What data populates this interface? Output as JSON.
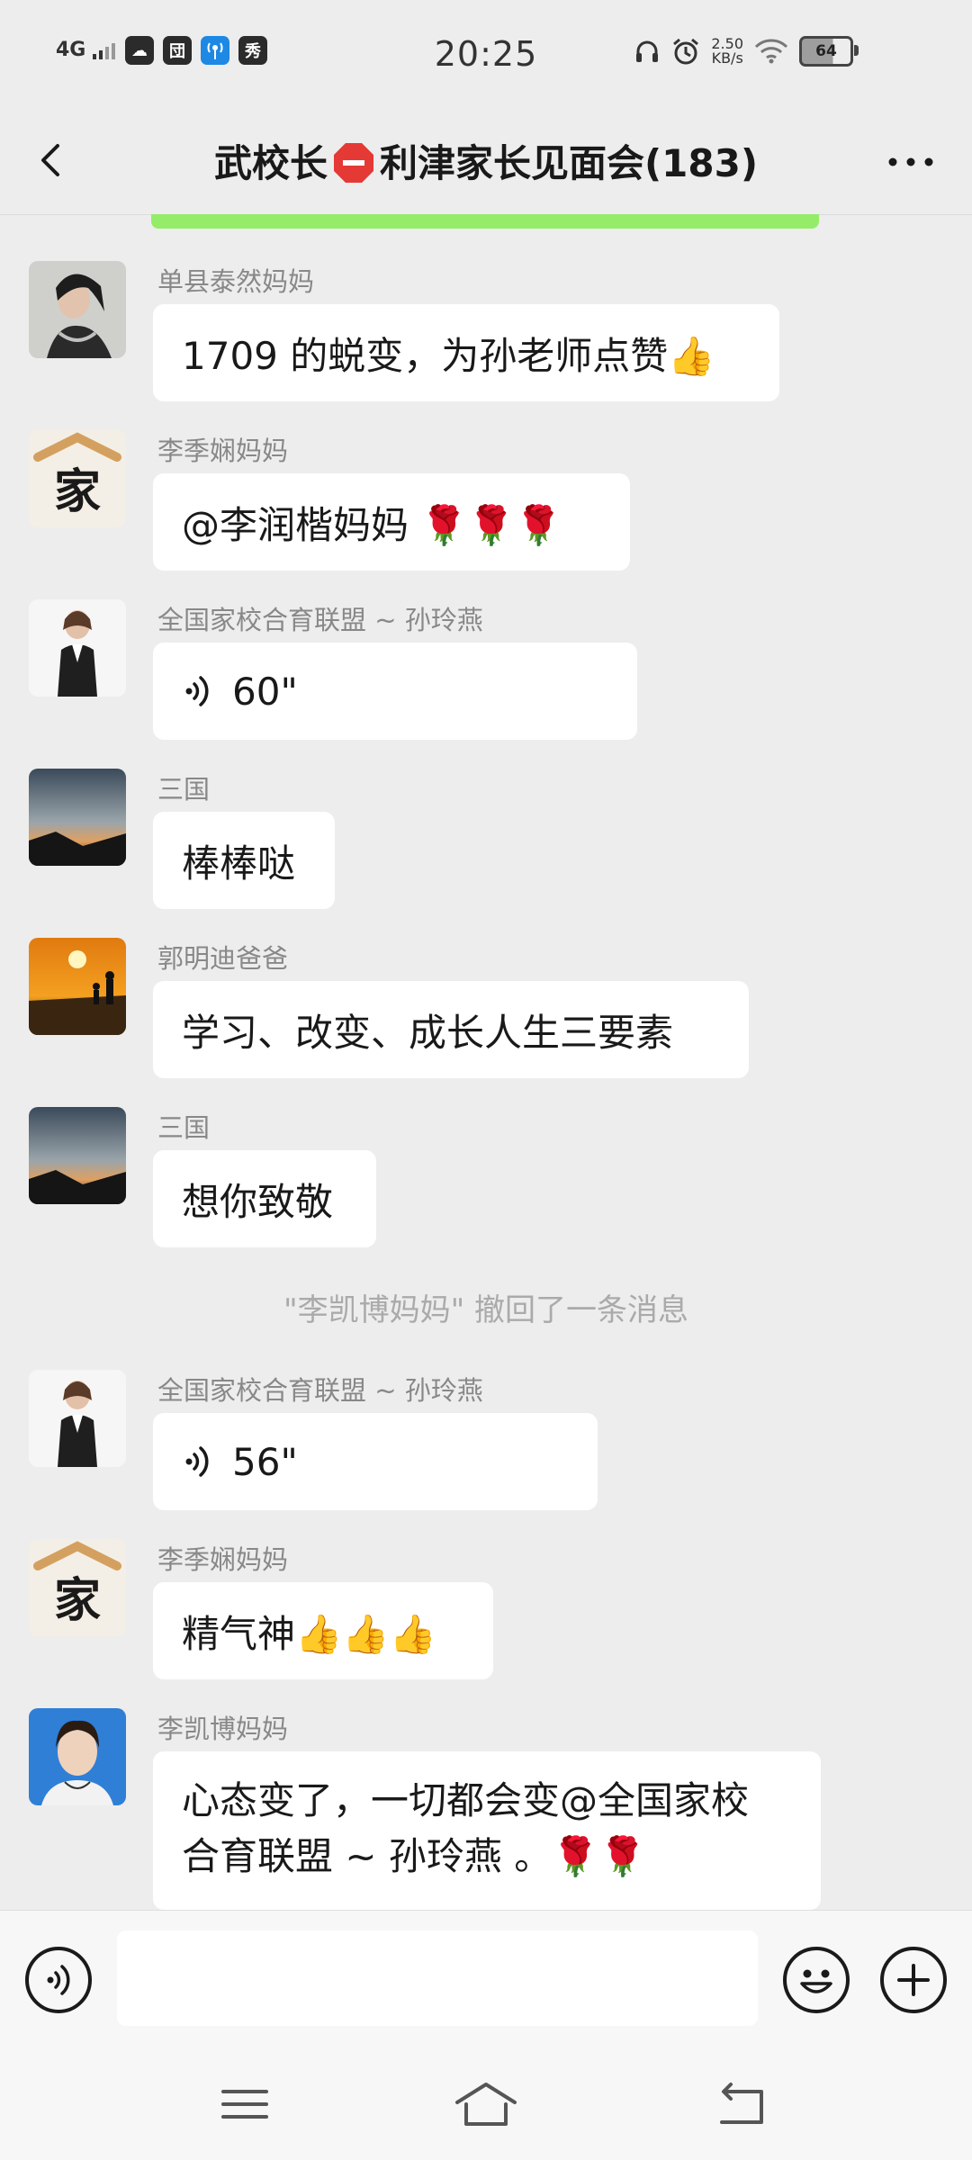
{
  "status_bar": {
    "network": "4G",
    "app_icons": [
      "cloud-icon",
      "sim-icon",
      "wifi-tower-icon",
      "xiu-icon"
    ],
    "app_icon_glyphs": [
      "☁",
      "団",
      "📶",
      "秀"
    ],
    "time": "20:25",
    "speed_value": "2.50",
    "speed_unit": "KB/s",
    "battery": "64"
  },
  "title_bar": {
    "title_part1": "武校长",
    "title_part2": "利津家长见面会(183)"
  },
  "messages": [
    {
      "sender": "单县泰然妈妈",
      "text": "1709 的蜕变，为孙老师点赞👍"
    },
    {
      "sender": "李季娴妈妈",
      "text": "@李润楷妈妈 🌹🌹🌹"
    },
    {
      "sender": "全国家校合育联盟 ~ 孙玲燕",
      "voice": "60\""
    },
    {
      "sender": "三国",
      "text": "棒棒哒"
    },
    {
      "sender": "郭明迪爸爸",
      "text": "学习、改变、成长人生三要素"
    },
    {
      "sender": "三国",
      "text": "想你致敬"
    },
    {
      "sender": "全国家校合育联盟 ~ 孙玲燕",
      "voice": "56\""
    },
    {
      "sender": "李季娴妈妈",
      "text": "精气神👍👍👍"
    },
    {
      "sender": "李凯博妈妈",
      "text_line1": "心态变了，一切都会变@全国家校",
      "text_line2": "合育联盟 ~ 孙玲燕 。🌹🌹"
    }
  ],
  "system_note": "\"李凯博妈妈\" 撤回了一条消息",
  "avatar_glyph": "家",
  "input_bar": {
    "placeholder": ""
  },
  "colors": {
    "accent_green": "#95ec69",
    "background": "#ededed",
    "bubble": "#ffffff"
  }
}
